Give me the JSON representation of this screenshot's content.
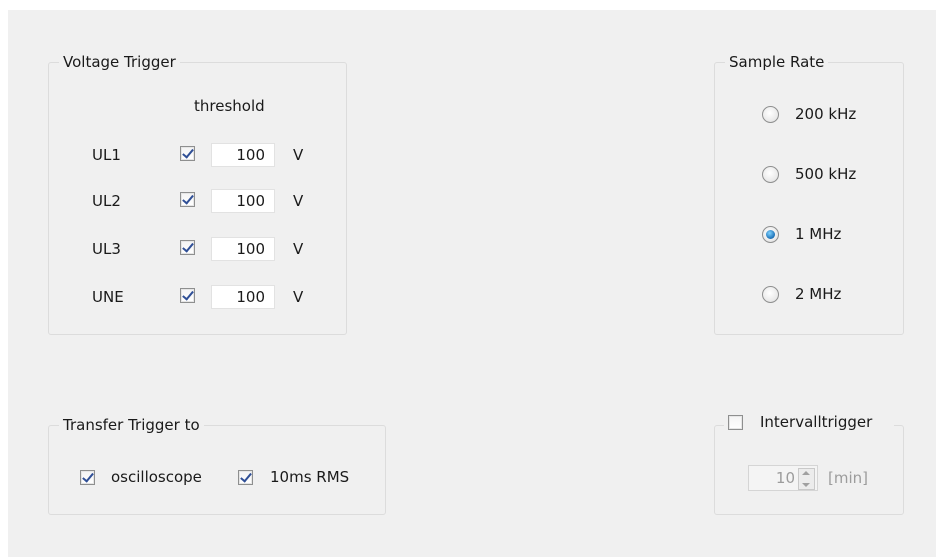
{
  "voltage_trigger": {
    "title": "Voltage Trigger",
    "threshold_header": "threshold",
    "rows": [
      {
        "label": "UL1",
        "checked": true,
        "value": "100",
        "unit": "V"
      },
      {
        "label": "UL2",
        "checked": true,
        "value": "100",
        "unit": "V"
      },
      {
        "label": "UL3",
        "checked": true,
        "value": "100",
        "unit": "V"
      },
      {
        "label": "UNE",
        "checked": true,
        "value": "100",
        "unit": "V"
      }
    ]
  },
  "sample_rate": {
    "title": "Sample Rate",
    "options": [
      {
        "label": "200 kHz",
        "selected": false
      },
      {
        "label": "500 kHz",
        "selected": false
      },
      {
        "label": "1 MHz",
        "selected": true
      },
      {
        "label": "2 MHz",
        "selected": false
      }
    ]
  },
  "transfer_trigger": {
    "title": "Transfer Trigger to",
    "options": [
      {
        "label": "oscilloscope",
        "checked": true
      },
      {
        "label": "10ms RMS",
        "checked": true
      }
    ]
  },
  "interval_trigger": {
    "title": "Intervalltrigger",
    "checked": false,
    "value": "10",
    "unit": "[min]"
  }
}
